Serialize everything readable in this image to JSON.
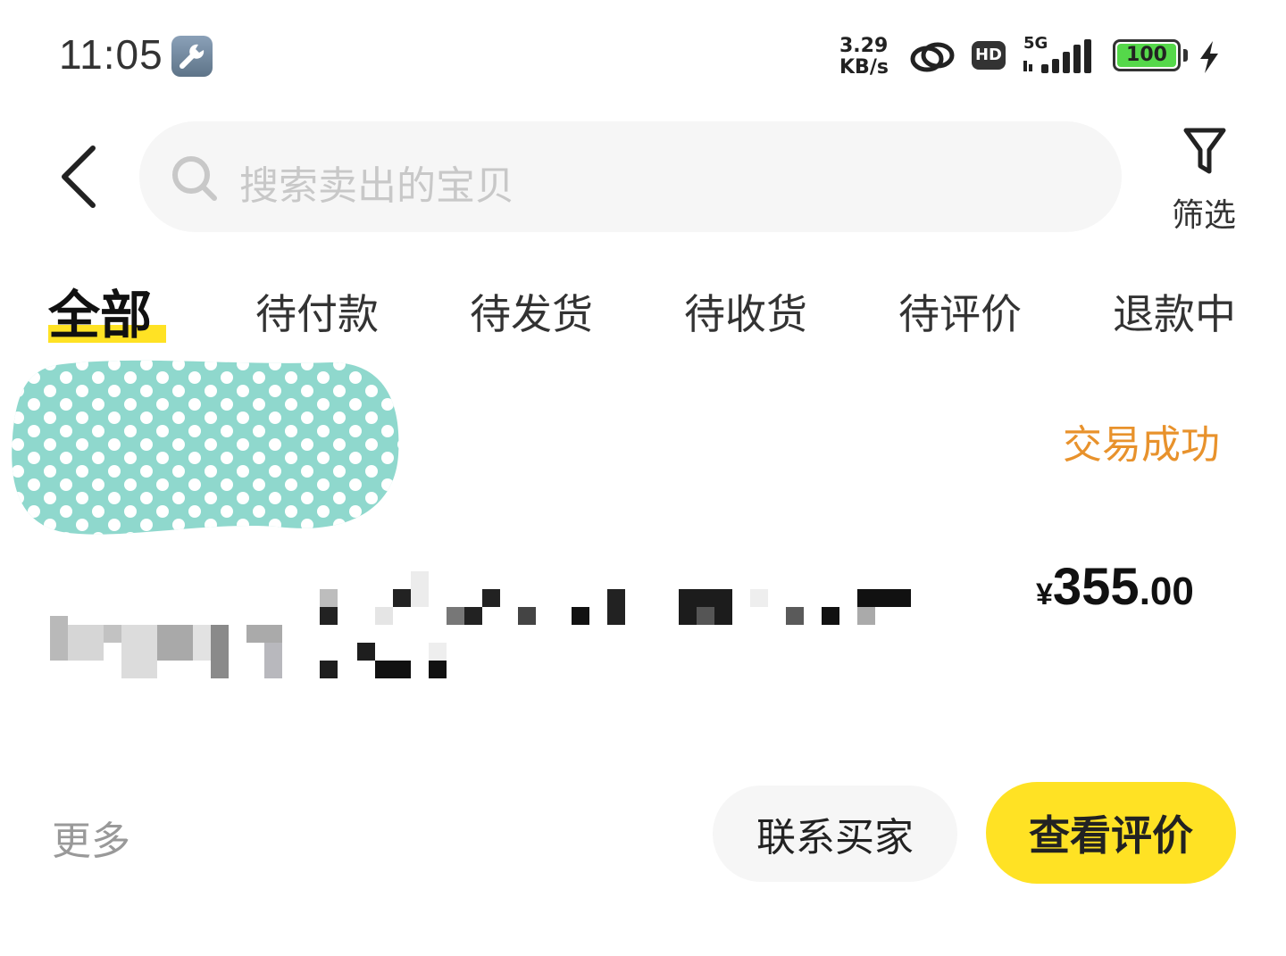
{
  "status_bar": {
    "time": "11:05",
    "net_speed_value": "3.29",
    "net_speed_unit": "KB/s",
    "hd_label": "HD",
    "network_label": "5G",
    "battery_level": "100",
    "icons": [
      "wrench-icon",
      "link-icon",
      "hd-icon",
      "signal-icon",
      "battery-icon",
      "charging-bolt-icon"
    ]
  },
  "header": {
    "search_placeholder": "搜索卖出的宝贝",
    "filter_label": "筛选"
  },
  "tabs": [
    {
      "label": "全部",
      "active": true
    },
    {
      "label": "待付款"
    },
    {
      "label": "待发货"
    },
    {
      "label": "待收货"
    },
    {
      "label": "待评价"
    },
    {
      "label": "退款中"
    }
  ],
  "order": {
    "status": "交易成功",
    "price_symbol": "¥",
    "price_int": "355",
    "price_dec": ".00",
    "more_label": "更多",
    "contact_button": "联系买家",
    "review_button": "查看评价"
  },
  "colors": {
    "accent_yellow": "#ffe224",
    "status_orange": "#e8922c",
    "mask_teal": "#8fd8cd"
  }
}
